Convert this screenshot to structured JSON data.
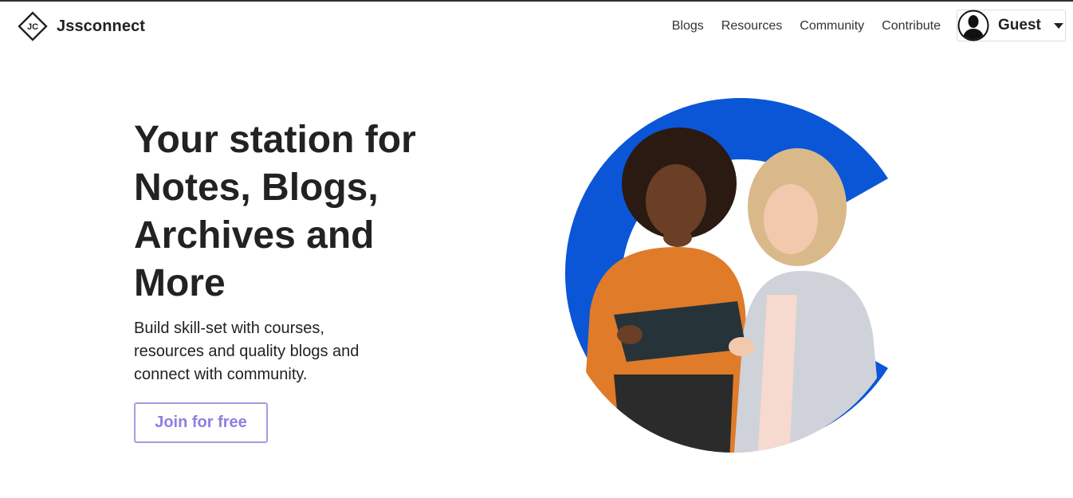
{
  "brand": {
    "logo_text": "JC",
    "name": "Jssconnect"
  },
  "nav": {
    "links": [
      {
        "label": "Blogs"
      },
      {
        "label": "Resources"
      },
      {
        "label": "Community"
      },
      {
        "label": "Contribute"
      }
    ]
  },
  "user": {
    "name": "Guest",
    "avatar_icon": "user-silhouette-icon"
  },
  "hero": {
    "title": "Your station for Notes, Blogs, Archives and More",
    "subtitle": "Build skill-set with courses, resources and quality blogs and connect with community.",
    "cta_label": "Join for free"
  },
  "colors": {
    "accent_blue": "#0a56d6",
    "cta_border": "#a99ae3",
    "cta_text": "#8f7fe0",
    "text": "#222222"
  }
}
